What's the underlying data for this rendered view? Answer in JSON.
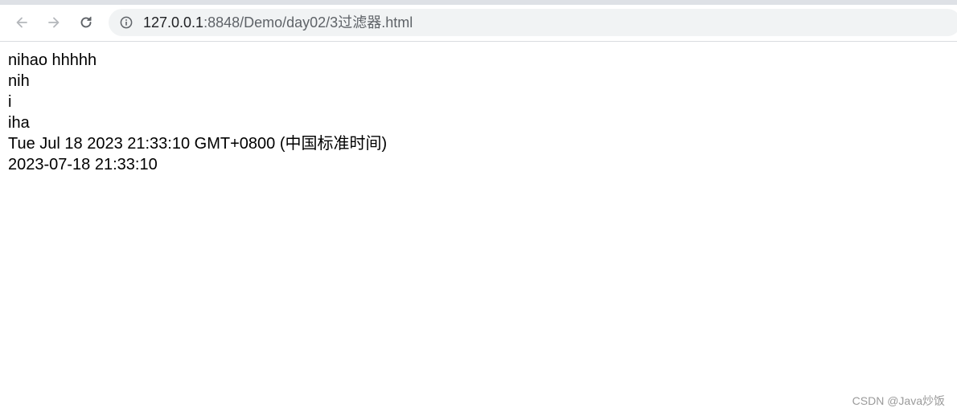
{
  "browser": {
    "url_host": "127.0.0.1",
    "url_path": ":8848/Demo/day02/3过滤器.html",
    "icons": {
      "back": "arrow-left-icon",
      "forward": "arrow-right-icon",
      "reload": "reload-icon",
      "site_info": "info-circle-icon"
    }
  },
  "page": {
    "lines": [
      "nihao hhhhh",
      "nih",
      "i",
      "iha",
      "Tue Jul 18 2023 21:33:10 GMT+0800 (中国标准时间)",
      "2023-07-18 21:33:10"
    ]
  },
  "watermark": "CSDN @Java炒饭",
  "colors": {
    "toolbar_bg": "#ffffff",
    "omnibox_bg": "#f1f3f4",
    "text": "#000000"
  }
}
